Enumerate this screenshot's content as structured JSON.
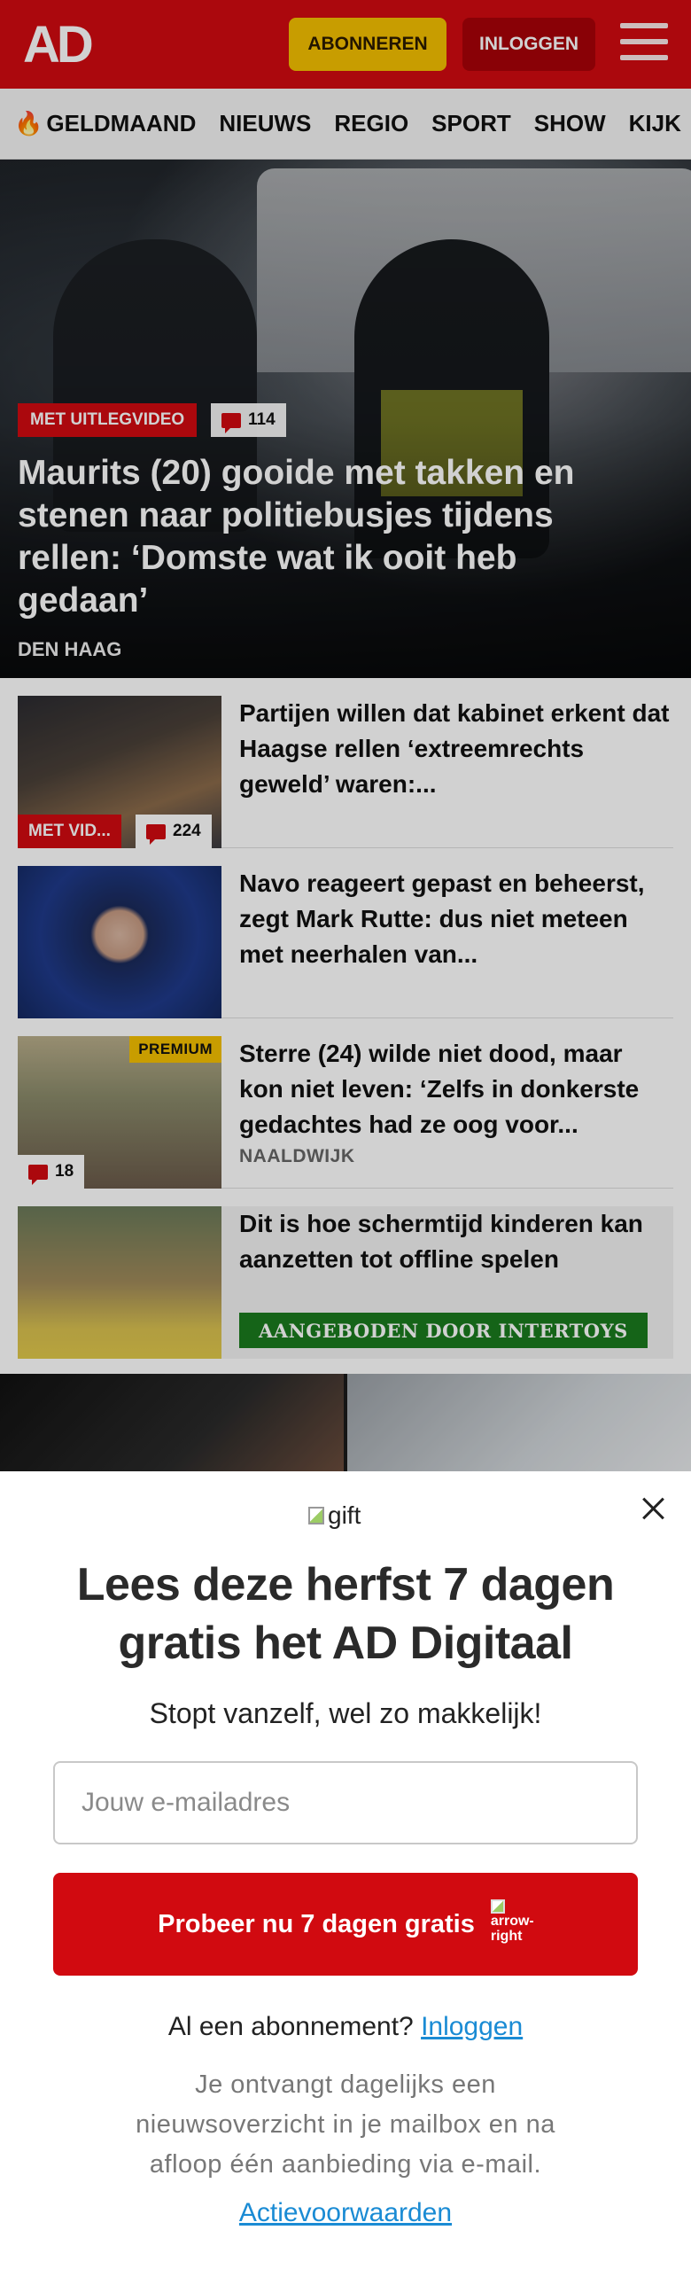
{
  "header": {
    "logo": "AD",
    "subscribe_label": "ABONNEREN",
    "login_label": "INLOGGEN",
    "colors": {
      "brand": "#d10a10",
      "subscribe": "#f5c000"
    }
  },
  "nav": {
    "items": [
      "GELDMAAND",
      "NIEUWS",
      "REGIO",
      "SPORT",
      "SHOW",
      "KIJK"
    ]
  },
  "hero": {
    "tag": "MET UITLEGVIDEO",
    "comments": "114",
    "title": "Maurits (20) gooide met takken en stenen naar politiebusjes tijdens rellen: ‘Domste wat ik ooit heb gedaan’",
    "location": "DEN HAAG"
  },
  "articles": [
    {
      "title": "Partijen willen dat kabinet erkent dat Haagse rellen ‘extreemrechts geweld’ waren:...",
      "tag": "MET VID...",
      "comments": "224"
    },
    {
      "title": "Navo reageert gepast en beheerst, zegt Mark Rutte: dus niet meteen met neerhalen van..."
    },
    {
      "title": "Sterre (24) wilde niet dood, maar kon niet leven: ‘Zelfs in donkerste gedachtes had ze oog voor...",
      "premium": "PREMIUM",
      "comments": "18",
      "location": "NAALDWIJK"
    },
    {
      "title": "Dit is hoe schermtijd kinderen kan aanzetten tot offline spelen",
      "sponsor": "AANGEBODEN DOOR INTERTOYS"
    }
  ],
  "modal": {
    "gift_alt": "gift",
    "title": "Lees deze herfst 7 dagen gratis het AD Digitaal",
    "subtitle": "Stopt vanzelf, wel zo makkelijk!",
    "email_placeholder": "Jouw e-mailadres",
    "cta_label": "Probeer nu 7 dagen gratis",
    "cta_icon_alt": "arrow-right",
    "login_prompt": "Al een abonnement?",
    "login_link": "Inloggen",
    "info": "Je ontvangt dagelijks een nieuwsoverzicht in je mailbox en na afloop één aanbieding via e-mail.",
    "terms": "Actievoorwaarden"
  }
}
